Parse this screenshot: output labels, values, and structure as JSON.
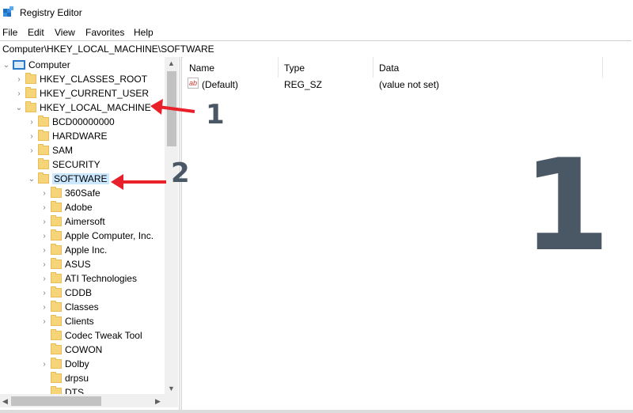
{
  "window": {
    "title": "Registry Editor"
  },
  "menu": [
    "File",
    "Edit",
    "View",
    "Favorites",
    "Help"
  ],
  "address": "Computer\\HKEY_LOCAL_MACHINE\\SOFTWARE",
  "tree": {
    "root": "Computer",
    "hives": [
      "HKEY_CLASSES_ROOT",
      "HKEY_CURRENT_USER",
      "HKEY_LOCAL_MACHINE"
    ],
    "hklm_children": [
      "BCD00000000",
      "HARDWARE",
      "SAM",
      "SECURITY",
      "SOFTWARE"
    ],
    "software_children": [
      "360Safe",
      "Adobe",
      "Aimersoft",
      "Apple Computer, Inc.",
      "Apple Inc.",
      "ASUS",
      "ATI Technologies",
      "CDDB",
      "Classes",
      "Clients",
      "Codec Tweak Tool",
      "COWON",
      "Dolby",
      "drpsu",
      "DTS"
    ],
    "selected": "SOFTWARE"
  },
  "list": {
    "columns": [
      "Name",
      "Type",
      "Data"
    ],
    "rows": [
      {
        "name": "(Default)",
        "type": "REG_SZ",
        "data": "(value not set)"
      }
    ]
  },
  "annotations": {
    "label_1": "1",
    "label_2": "2",
    "big_label": "1",
    "arrow_color": "#e8202a",
    "label_color": "#4a5866"
  },
  "colors": {
    "selection": "#cce8ff",
    "folder": "#f6d47a"
  }
}
